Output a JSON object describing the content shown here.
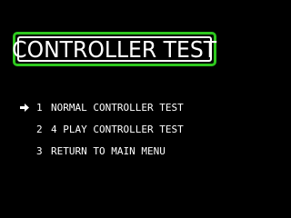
{
  "screen": {
    "title": "CONTROLLER TEST",
    "colors": {
      "background": "#000000",
      "text": "#ffffff",
      "frame_outer": "#2ec81e",
      "frame_inner": "#ffffff"
    }
  },
  "menu": {
    "cursor_icon": "right-arrow-icon",
    "selected_index": 0,
    "items": [
      {
        "number": "1",
        "label": "NORMAL CONTROLLER TEST"
      },
      {
        "number": "2",
        "label": "4 PLAY CONTROLLER TEST"
      },
      {
        "number": "3",
        "label": "RETURN TO MAIN MENU"
      }
    ]
  }
}
